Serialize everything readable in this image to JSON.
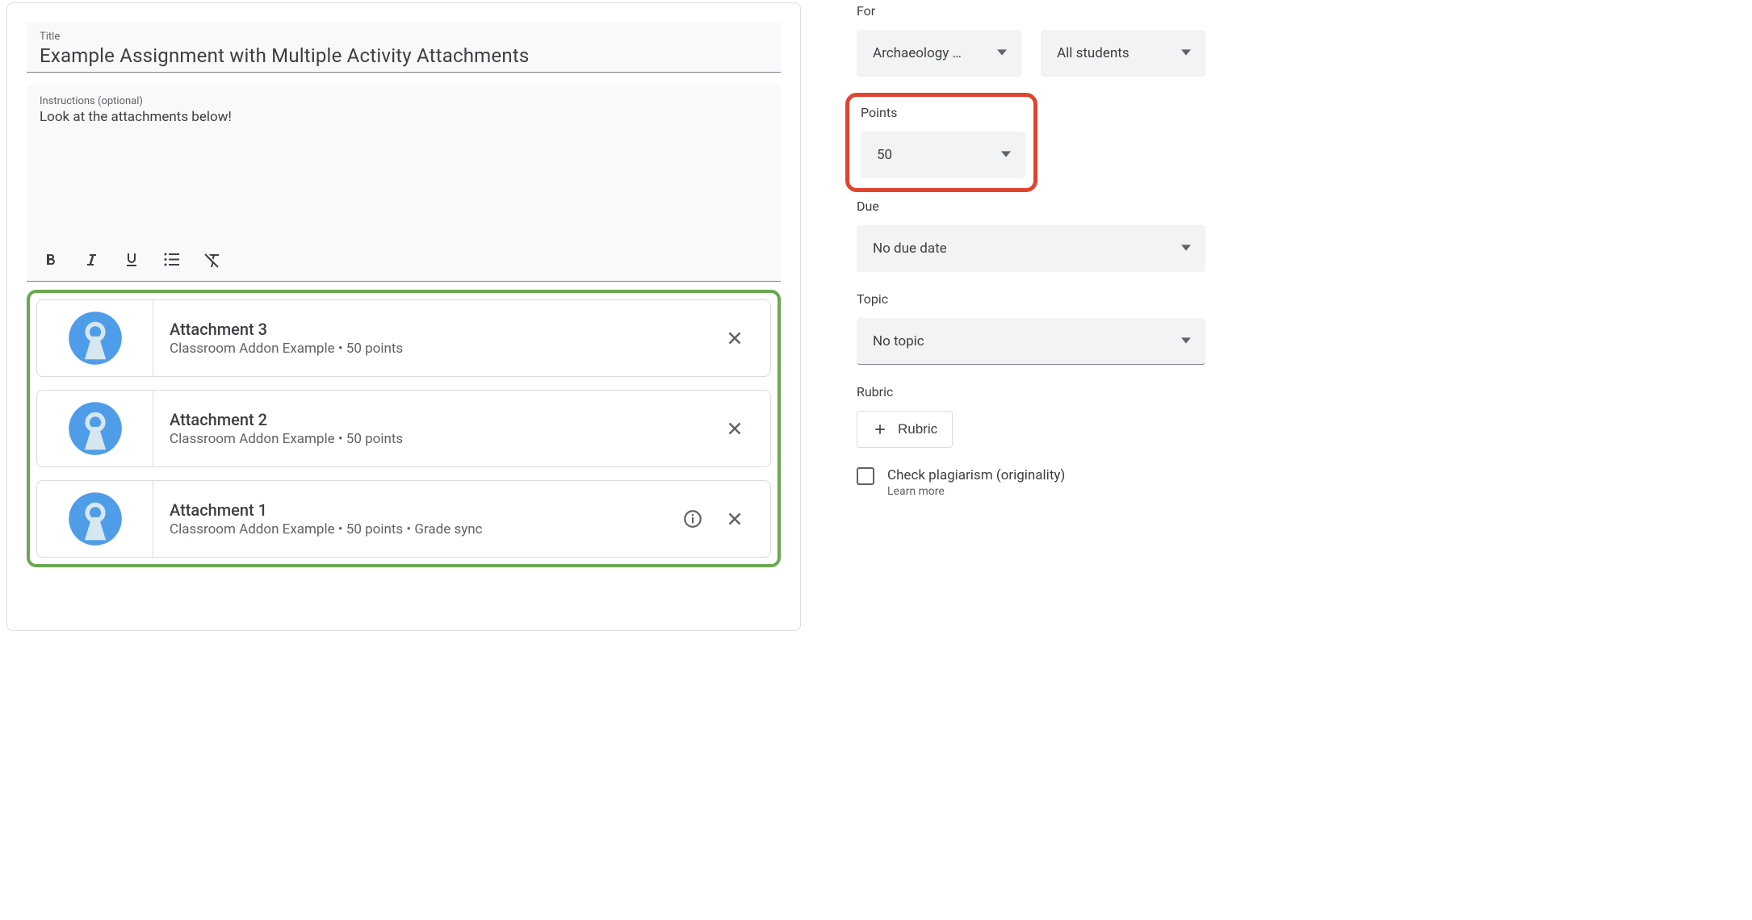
{
  "title": {
    "label": "Title",
    "value": "Example Assignment with Multiple Activity Attachments"
  },
  "instructions": {
    "label": "Instructions (optional)",
    "value": "Look at the attachments below!"
  },
  "attachments": [
    {
      "title": "Attachment 3",
      "subtitle": "Classroom Addon Example • 50 points",
      "has_info": false
    },
    {
      "title": "Attachment 2",
      "subtitle": "Classroom Addon Example • 50 points",
      "has_info": false
    },
    {
      "title": "Attachment 1",
      "subtitle": "Classroom Addon Example • 50 points • Grade sync",
      "has_info": true
    }
  ],
  "sidebar": {
    "for_label": "For",
    "for_class": "Archaeology …",
    "for_students": "All students",
    "points_label": "Points",
    "points_value": "50",
    "due_label": "Due",
    "due_value": "No due date",
    "topic_label": "Topic",
    "topic_value": "No topic",
    "rubric_label": "Rubric",
    "rubric_button": "Rubric",
    "plagiarism_label": "Check plagiarism (originality)",
    "learn_more": "Learn more"
  }
}
